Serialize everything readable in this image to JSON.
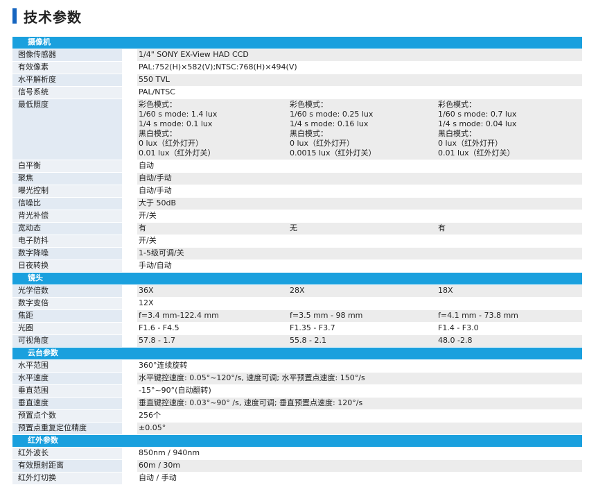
{
  "page": {
    "title": "技术参数"
  },
  "sections": [
    {
      "name": "摄像机",
      "rows": [
        {
          "label": "图像传感器",
          "values": [
            "1/4\" SONY EX-View HAD CCD"
          ]
        },
        {
          "label": "有效像素",
          "values": [
            "PAL:752(H)×582(V);NTSC:768(H)×494(V)"
          ]
        },
        {
          "label": "水平解析度",
          "values": [
            "550 TVL"
          ]
        },
        {
          "label": "信号系统",
          "values": [
            "PAL/NTSC"
          ]
        },
        {
          "label": "最低照度",
          "multiline": true,
          "values": [
            [
              "彩色模式：",
              "1/60 s mode: 1.4 lux",
              "1/4 s  mode: 0.1 lux",
              "黑白模式：",
              "0 lux（红外灯开）",
              "0.01 lux（红外灯关）"
            ],
            [
              "彩色模式：",
              "1/60 s mode: 0.25 lux",
              "1/4 s  mode: 0.16 lux",
              "黑白模式：",
              "0 lux（红外灯开）",
              "0.0015 lux（红外灯关）"
            ],
            [
              "彩色模式：",
              "1/60 s mode: 0.7 lux",
              "1/4 s  mode: 0.04 lux",
              "黑白模式：",
              "0 lux（红外灯开）",
              "0.01 lux（红外灯关）"
            ]
          ]
        },
        {
          "label": "白平衡",
          "values": [
            "自动"
          ]
        },
        {
          "label": "聚焦",
          "values": [
            "自动/手动"
          ]
        },
        {
          "label": "曝光控制",
          "values": [
            "自动/手动"
          ]
        },
        {
          "label": "信噪比",
          "values": [
            "大于 50dB"
          ]
        },
        {
          "label": "背光补偿",
          "values": [
            "开/关"
          ]
        },
        {
          "label": "宽动态",
          "values": [
            "有",
            "无",
            "有"
          ]
        },
        {
          "label": "电子防抖",
          "values": [
            "开/关"
          ]
        },
        {
          "label": "数字降噪",
          "values": [
            "1-5级可调/关"
          ]
        },
        {
          "label": "日夜转换",
          "values": [
            "手动/自动"
          ]
        }
      ]
    },
    {
      "name": "镜头",
      "rows": [
        {
          "label": "光学倍数",
          "values": [
            "36X",
            "28X",
            "18X"
          ]
        },
        {
          "label": "数字变倍",
          "values": [
            "12X"
          ]
        },
        {
          "label": "焦距",
          "values": [
            "f=3.4 mm-122.4 mm",
            "f=3.5 mm - 98 mm",
            "f=4.1 mm - 73.8 mm"
          ]
        },
        {
          "label": "光圈",
          "values": [
            "F1.6 - F4.5",
            "F1.35 - F3.7",
            "F1.4 - F3.0"
          ]
        },
        {
          "label": "可视角度",
          "values": [
            "57.8 - 1.7",
            "55.8 - 2.1",
            "48.0 -2.8"
          ]
        }
      ]
    },
    {
      "name": "云台参数",
      "rows": [
        {
          "label": "水平范围",
          "values": [
            "360°连续旋转"
          ]
        },
        {
          "label": "水平速度",
          "values": [
            "水平键控速度: 0.05°~120°/s, 速度可调; 水平预置点速度: 150°/s"
          ]
        },
        {
          "label": "垂直范围",
          "values": [
            "-15°~90°(自动翻转)"
          ]
        },
        {
          "label": "垂直速度",
          "values": [
            "垂直键控速度: 0.03°~90° /s, 速度可调; 垂直预置点速度: 120°/s"
          ]
        },
        {
          "label": "预置点个数",
          "values": [
            "256个"
          ]
        },
        {
          "label": "预置点重复定位精度",
          "values": [
            "±0.05°"
          ]
        }
      ]
    },
    {
      "name": "红外参数",
      "rows": [
        {
          "label": "红外波长",
          "values": [
            "850nm / 940nm"
          ]
        },
        {
          "label": "有效照射距离",
          "values": [
            "60m / 30m"
          ]
        },
        {
          "label": "红外灯切换",
          "values": [
            "自动 / 手动"
          ]
        }
      ]
    }
  ]
}
